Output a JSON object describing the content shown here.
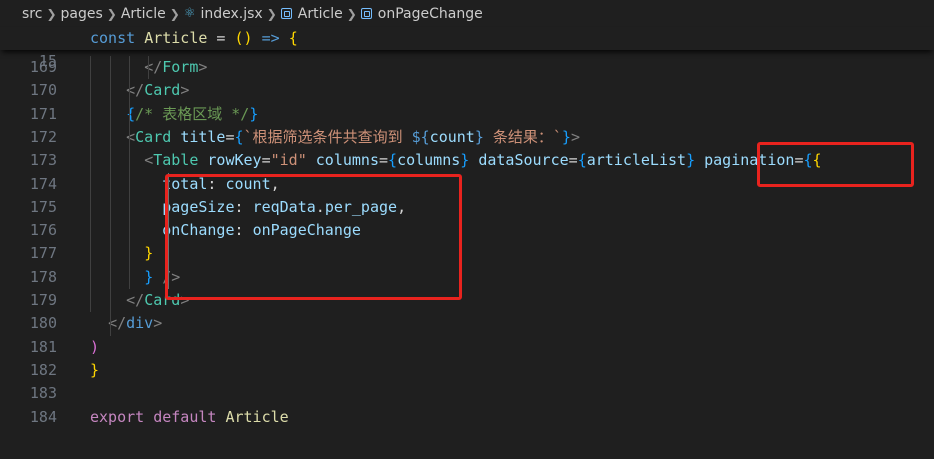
{
  "breadcrumb": [
    {
      "label": "src",
      "icon": ""
    },
    {
      "label": "pages",
      "icon": ""
    },
    {
      "label": "Article",
      "icon": ""
    },
    {
      "label": "index.jsx",
      "icon": "react-icon"
    },
    {
      "label": "Article",
      "icon": "symbol-icon"
    },
    {
      "label": "onPageChange",
      "icon": "symbol-icon"
    }
  ],
  "sticky_line": {
    "number": "15",
    "tokens": [
      [
        "kw",
        "const"
      ],
      [
        "pl",
        " "
      ],
      [
        "fn",
        "Article"
      ],
      [
        "pl",
        " = "
      ],
      [
        "b1",
        "("
      ],
      [
        "b1",
        ")"
      ],
      [
        "pl",
        " "
      ],
      [
        "kw",
        "=>"
      ],
      [
        "pl",
        " "
      ],
      [
        "b1",
        "{"
      ]
    ]
  },
  "lines": [
    {
      "number": "169",
      "tokens": [
        [
          "pl",
          "      "
        ],
        [
          "tag",
          "</"
        ],
        [
          "ty",
          "Form"
        ],
        [
          "tag",
          ">"
        ]
      ]
    },
    {
      "number": "170",
      "tokens": [
        [
          "pl",
          "    "
        ],
        [
          "tag",
          "</"
        ],
        [
          "ty",
          "Card"
        ],
        [
          "tag",
          ">"
        ]
      ]
    },
    {
      "number": "171",
      "tokens": [
        [
          "pl",
          "    "
        ],
        [
          "b3",
          "{"
        ],
        [
          "cm",
          "/* 表格区域 */"
        ],
        [
          "b3",
          "}"
        ]
      ]
    },
    {
      "number": "172",
      "tokens": [
        [
          "pl",
          "    "
        ],
        [
          "tag",
          "<"
        ],
        [
          "ty",
          "Card"
        ],
        [
          "pl",
          " "
        ],
        [
          "id",
          "title"
        ],
        [
          "pl",
          "="
        ],
        [
          "b3",
          "{"
        ],
        [
          "str",
          "`根据筛选条件共查询到 "
        ],
        [
          "kw",
          "${"
        ],
        [
          "id",
          "count"
        ],
        [
          "kw",
          "}"
        ],
        [
          "str",
          " 条结果：`"
        ],
        [
          "b3",
          "}"
        ],
        [
          "tag",
          ">"
        ]
      ]
    },
    {
      "number": "173",
      "tokens": [
        [
          "pl",
          "      "
        ],
        [
          "tag",
          "<"
        ],
        [
          "ty",
          "Table"
        ],
        [
          "pl",
          " "
        ],
        [
          "id",
          "rowKey"
        ],
        [
          "pl",
          "="
        ],
        [
          "str",
          "\"id\""
        ],
        [
          "pl",
          " "
        ],
        [
          "id",
          "columns"
        ],
        [
          "pl",
          "="
        ],
        [
          "b3",
          "{"
        ],
        [
          "id",
          "columns"
        ],
        [
          "b3",
          "}"
        ],
        [
          "pl",
          " "
        ],
        [
          "id",
          "dataSource"
        ],
        [
          "pl",
          "="
        ],
        [
          "b3",
          "{"
        ],
        [
          "id",
          "articleList"
        ],
        [
          "b3",
          "}"
        ],
        [
          "pl",
          " "
        ],
        [
          "id",
          "pagination"
        ],
        [
          "pl",
          "="
        ],
        [
          "b3",
          "{"
        ],
        [
          "b1",
          "{"
        ]
      ]
    },
    {
      "number": "174",
      "tokens": [
        [
          "pl",
          "        "
        ],
        [
          "id",
          "total"
        ],
        [
          "pl",
          ": "
        ],
        [
          "id",
          "count"
        ],
        [
          "pl",
          ","
        ]
      ]
    },
    {
      "number": "175",
      "tokens": [
        [
          "pl",
          "        "
        ],
        [
          "id",
          "pageSize"
        ],
        [
          "pl",
          ": "
        ],
        [
          "id",
          "reqData"
        ],
        [
          "pl",
          "."
        ],
        [
          "id",
          "per_page"
        ],
        [
          "pl",
          ","
        ]
      ]
    },
    {
      "number": "176",
      "tokens": [
        [
          "pl",
          "        "
        ],
        [
          "id",
          "onChange"
        ],
        [
          "pl",
          ": "
        ],
        [
          "id",
          "onPageChange"
        ]
      ]
    },
    {
      "number": "177",
      "tokens": [
        [
          "pl",
          "      "
        ],
        [
          "b1",
          "}"
        ]
      ]
    },
    {
      "number": "178",
      "tokens": [
        [
          "pl",
          "      "
        ],
        [
          "b3",
          "}"
        ],
        [
          "pl",
          " "
        ],
        [
          "tag",
          "/>"
        ]
      ]
    },
    {
      "number": "179",
      "tokens": [
        [
          "pl",
          "    "
        ],
        [
          "tag",
          "</"
        ],
        [
          "ty",
          "Card"
        ],
        [
          "tag",
          ">"
        ]
      ]
    },
    {
      "number": "180",
      "tokens": [
        [
          "pl",
          "  "
        ],
        [
          "tag",
          "</"
        ],
        [
          "kw",
          "div"
        ],
        [
          "tag",
          ">"
        ]
      ]
    },
    {
      "number": "181",
      "tokens": [
        [
          "b2",
          ")"
        ]
      ]
    },
    {
      "number": "182",
      "tokens": [
        [
          "b1",
          "}"
        ]
      ]
    },
    {
      "number": "183",
      "tokens": []
    },
    {
      "number": "184",
      "tokens": [
        [
          "ctl",
          "export"
        ],
        [
          "pl",
          " "
        ],
        [
          "ctl",
          "default"
        ],
        [
          "pl",
          " "
        ],
        [
          "fn",
          "Article"
        ]
      ]
    }
  ]
}
